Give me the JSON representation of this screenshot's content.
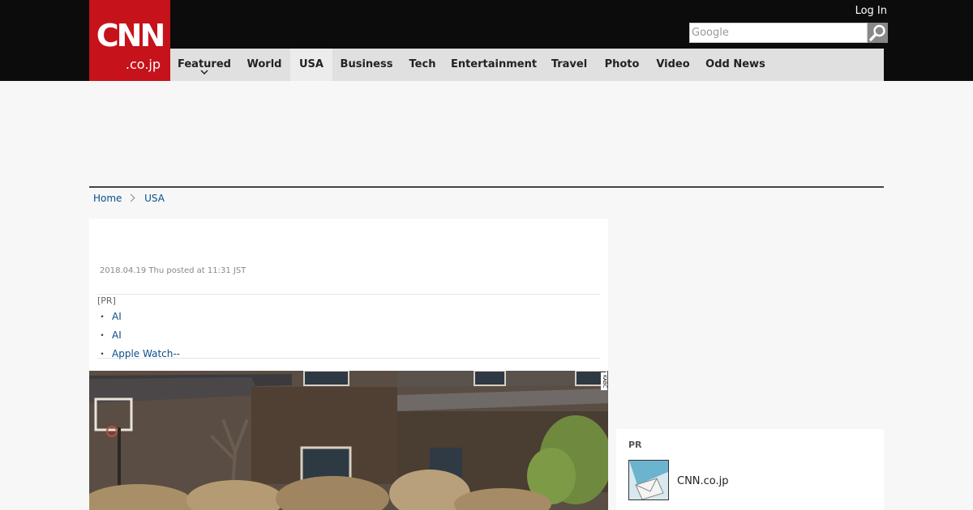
{
  "header": {
    "logo_main": "CNN",
    "logo_sub": ".co.jp",
    "login_label": "Log In",
    "search_placeholder": "Google"
  },
  "nav": {
    "items": [
      {
        "label": "Featured",
        "has_dropdown": true
      },
      {
        "label": "World"
      },
      {
        "label": "USA",
        "active": true
      },
      {
        "label": "Business"
      },
      {
        "label": "Tech"
      },
      {
        "label": "Entertainment"
      },
      {
        "label": "Travel"
      },
      {
        "label": "Photo"
      },
      {
        "label": "Video"
      },
      {
        "label": "Odd News"
      }
    ]
  },
  "breadcrumb": {
    "home": "Home",
    "current": "USA"
  },
  "article": {
    "dateline": "2018.04.19 Thu posted at 11:31 JST",
    "pr_label": "[PR]",
    "pr_links": [
      "AI",
      "AI",
      "Apple Watch--"
    ],
    "photo_watermark": "KABC"
  },
  "sidebar": {
    "pr_label": "PR",
    "pr_item_text": "CNN.co.jp"
  },
  "colors": {
    "brand_red": "#c5121b",
    "topbar": "#0c0c0c",
    "nav_bg": "#e0e0e0",
    "link": "#0b4f8a"
  },
  "icons": {
    "search": "magnifier-icon",
    "dropdown": "chevron-down-icon",
    "breadcrumb_sep": "chevron-right-icon"
  }
}
